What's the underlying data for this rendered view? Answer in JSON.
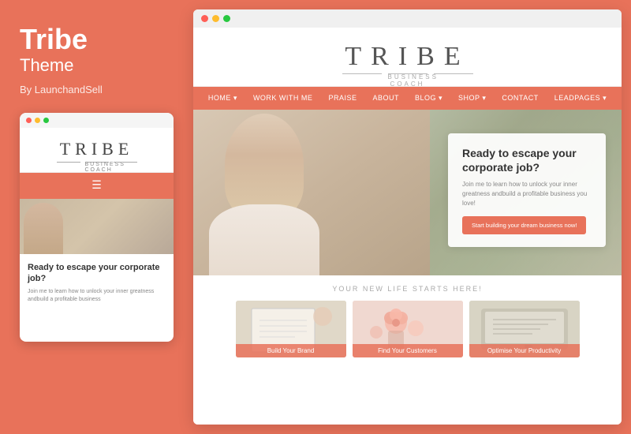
{
  "left": {
    "title": "Tribe",
    "subtitle": "Theme",
    "author": "By LaunchandSell"
  },
  "mobile_preview": {
    "logo": "TRIBE",
    "tagline": "BUSINESS COACH",
    "hero_title": "Ready to escape your corporate job?",
    "hero_text": "Join me to learn how to unlock your inner greatness andbuild a profitable business"
  },
  "desktop_preview": {
    "logo": "TRIBE",
    "tagline": "BUSINESS COACH",
    "nav_items": [
      "HOME ▾",
      "WORK WITH ME",
      "PRAISE",
      "ABOUT",
      "BLOG ▾",
      "SHOP ▾",
      "CONTACT",
      "LEADPAGES ▾"
    ],
    "hero": {
      "card_title": "Ready to escape your corporate job?",
      "card_text": "Join me to learn how to unlock your inner greatness andbuild a profitable business you love!",
      "card_btn": "Start building your dream business now!"
    },
    "section": {
      "subtitle": "YOUR NEW LIFE STARTS HERE!",
      "cards": [
        {
          "label": "Build Your Brand"
        },
        {
          "label": "Find Your Customers"
        },
        {
          "label": "Optimise Your Productivity"
        }
      ]
    }
  },
  "browser_dots": {
    "red": "#ff5f57",
    "yellow": "#febc2e",
    "green": "#28c840"
  }
}
